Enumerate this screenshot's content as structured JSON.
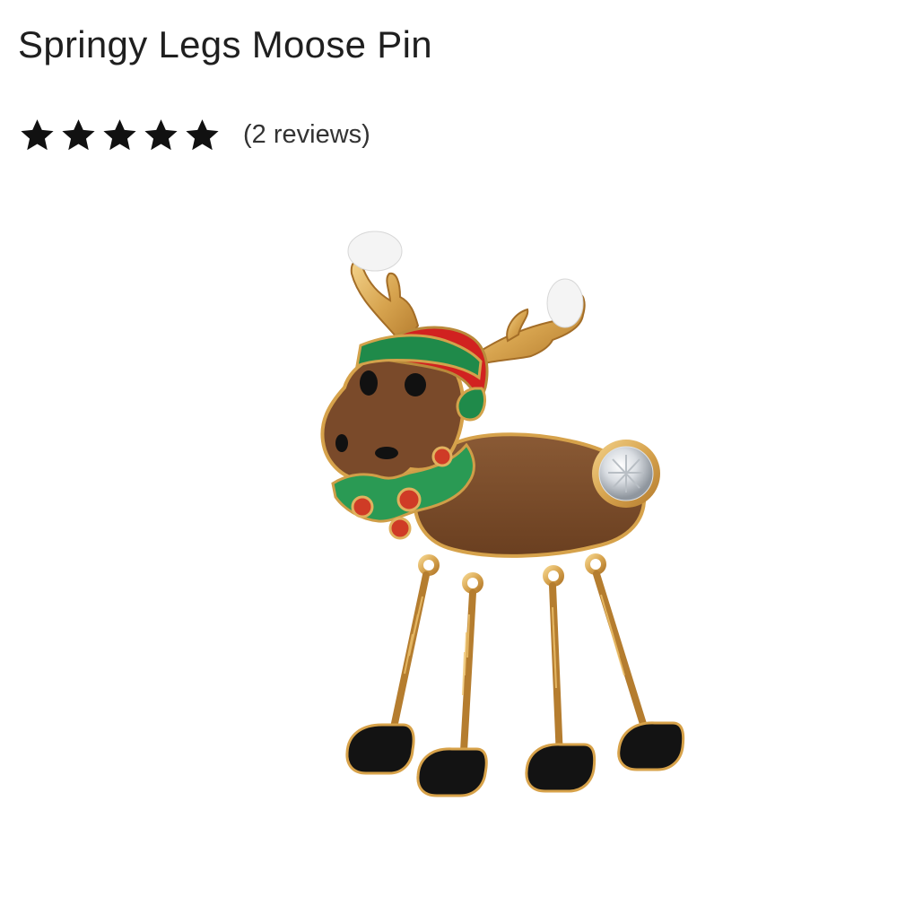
{
  "product": {
    "title": "Springy Legs Moose Pin",
    "rating": 5,
    "rating_max": 5,
    "reviews_text": "(2 reviews)",
    "image_icon": "moose-pin-image"
  },
  "colors": {
    "star": "#111111",
    "text": "#1f1f1f",
    "moose_body": "#7a4a2a",
    "hat_red": "#c8201f",
    "hat_green": "#1f8a4a",
    "gold": "#d8a855"
  }
}
